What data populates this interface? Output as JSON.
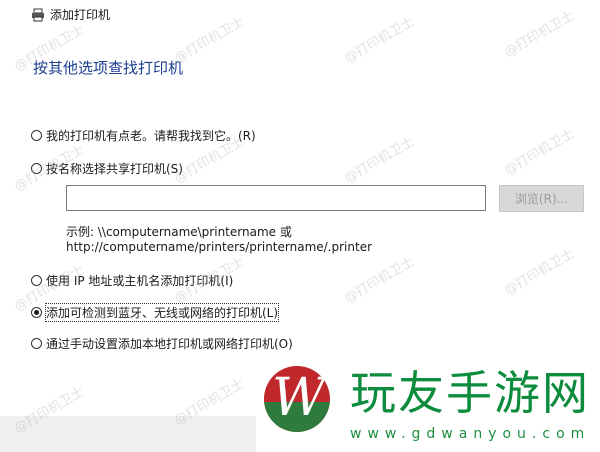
{
  "window": {
    "title": "添加打印机"
  },
  "heading": "按其他选项查找打印机",
  "options": [
    {
      "label": "我的打印机有点老。请帮我找到它。(R)",
      "checked": false
    },
    {
      "label": "按名称选择共享打印机(S)",
      "checked": false
    },
    {
      "label": "使用 IP 地址或主机名添加打印机(I)",
      "checked": false
    },
    {
      "label": "添加可检测到蓝牙、无线或网络的打印机(L)",
      "checked": true
    },
    {
      "label": "通过手动设置添加本地打印机或网络打印机(O)",
      "checked": false
    }
  ],
  "share": {
    "input_value": "",
    "browse_label": "浏览(R)...",
    "example_line1": "示例: \\\\computername\\printername 或",
    "example_line2": "http://computername/printers/printername/.printer"
  },
  "watermark": {
    "text": "@打印机卫士"
  },
  "logo": {
    "name": "玩友手游网",
    "url": "www.gdwanyou.com",
    "mark": "W"
  },
  "colors": {
    "heading": "#1b3f8f",
    "logo_red": "#c0282b",
    "logo_green": "#2f7b3d",
    "logo_text": "#0c8c3c"
  }
}
